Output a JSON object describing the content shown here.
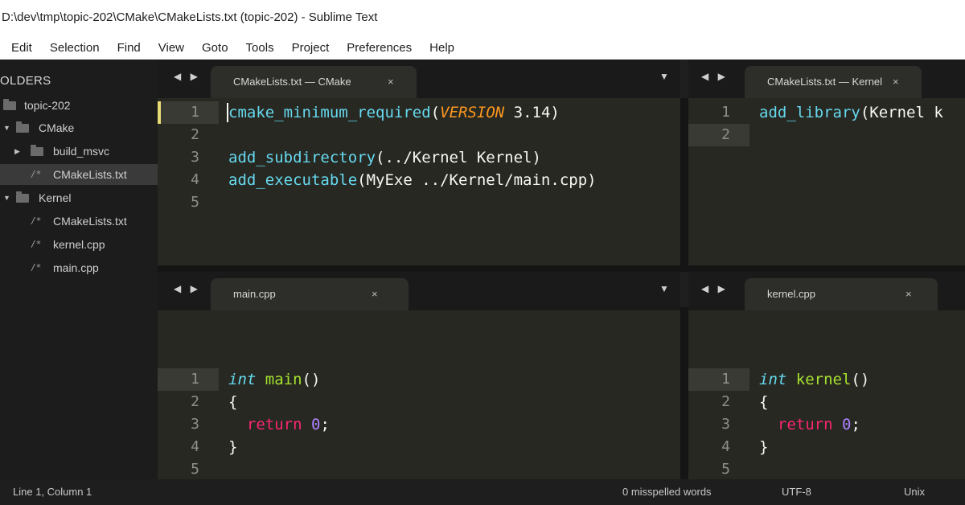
{
  "window": {
    "title": "D:\\dev\\tmp\\topic-202\\CMake\\CMakeLists.txt (topic-202) - Sublime Text"
  },
  "menu": [
    "Edit",
    "Selection",
    "Find",
    "View",
    "Goto",
    "Tools",
    "Project",
    "Preferences",
    "Help"
  ],
  "sidebar": {
    "header": "OLDERS",
    "tree": [
      {
        "label": "topic-202",
        "type": "folder",
        "depth": 0,
        "expanded": false,
        "selected": false
      },
      {
        "label": "CMake",
        "type": "folder",
        "depth": 0,
        "expanded": true,
        "selected": false
      },
      {
        "label": "build_msvc",
        "type": "folder",
        "depth": 1,
        "expanded": false,
        "selected": false
      },
      {
        "label": "CMakeLists.txt",
        "type": "file",
        "depth": 1,
        "selected": true
      },
      {
        "label": "Kernel",
        "type": "folder",
        "depth": 0,
        "expanded": true,
        "selected": false
      },
      {
        "label": "CMakeLists.txt",
        "type": "file",
        "depth": 1,
        "selected": false
      },
      {
        "label": "kernel.cpp",
        "type": "file",
        "depth": 1,
        "selected": false
      },
      {
        "label": "main.cpp",
        "type": "file",
        "depth": 1,
        "selected": false
      }
    ]
  },
  "panes": [
    {
      "tab": "CMakeLists.txt — CMake",
      "nav": "◀ ▶",
      "close": "×",
      "dropdown": "▼",
      "current_line": 1,
      "lines": [
        {
          "n": "1",
          "tokens": [
            [
              "cmake_minimum_required",
              "kw-func"
            ],
            [
              "(",
              ""
            ],
            [
              "VERSION",
              "kw-arg"
            ],
            [
              " 3.14)",
              ""
            ]
          ]
        },
        {
          "n": "2",
          "tokens": []
        },
        {
          "n": "3",
          "tokens": [
            [
              "add_subdirectory",
              "kw-func"
            ],
            [
              "(../Kernel Kernel)",
              ""
            ]
          ]
        },
        {
          "n": "4",
          "tokens": [
            [
              "add_executable",
              "kw-func"
            ],
            [
              "(MyExe ../Kernel/main.cpp)",
              ""
            ]
          ]
        },
        {
          "n": "5",
          "tokens": []
        }
      ]
    },
    {
      "tab": "CMakeLists.txt — Kernel",
      "nav": "◀ ▶",
      "close": "×",
      "dropdown": "",
      "current_line": 2,
      "lines": [
        {
          "n": "1",
          "tokens": [
            [
              "add_library",
              "kw-func"
            ],
            [
              "(Kernel k",
              ""
            ]
          ]
        },
        {
          "n": "2",
          "tokens": []
        }
      ]
    },
    {
      "tab": "main.cpp",
      "nav": "◀ ▶",
      "close": "×",
      "dropdown": "▼",
      "current_line": 1,
      "lines": [
        {
          "n": "1",
          "tokens": [
            [
              "int",
              "kw-type"
            ],
            [
              " ",
              ""
            ],
            [
              "main",
              "kw-name"
            ],
            [
              "()",
              ""
            ]
          ]
        },
        {
          "n": "2",
          "tokens": [
            [
              "{",
              ""
            ]
          ]
        },
        {
          "n": "3",
          "tokens": [
            [
              "  ",
              ""
            ],
            [
              "return",
              "kw-ret"
            ],
            [
              " ",
              ""
            ],
            [
              "0",
              "kw-num"
            ],
            [
              ";",
              ""
            ]
          ]
        },
        {
          "n": "4",
          "tokens": [
            [
              "}",
              ""
            ]
          ]
        },
        {
          "n": "5",
          "tokens": []
        }
      ]
    },
    {
      "tab": "kernel.cpp",
      "nav": "◀ ▶",
      "close": "×",
      "dropdown": "",
      "current_line": 1,
      "lines": [
        {
          "n": "1",
          "tokens": [
            [
              "int",
              "kw-type"
            ],
            [
              " ",
              ""
            ],
            [
              "kernel",
              "kw-name"
            ],
            [
              "()",
              ""
            ]
          ]
        },
        {
          "n": "2",
          "tokens": [
            [
              "{",
              ""
            ]
          ]
        },
        {
          "n": "3",
          "tokens": [
            [
              "  ",
              ""
            ],
            [
              "return",
              "kw-ret"
            ],
            [
              " ",
              ""
            ],
            [
              "0",
              "kw-num"
            ],
            [
              ";",
              ""
            ]
          ]
        },
        {
          "n": "4",
          "tokens": [
            [
              "}",
              ""
            ]
          ]
        },
        {
          "n": "5",
          "tokens": []
        }
      ]
    }
  ],
  "status": {
    "position": "Line 1, Column 1",
    "spelling": "0 misspelled words",
    "encoding": "UTF-8",
    "line_endings": "Unix"
  }
}
